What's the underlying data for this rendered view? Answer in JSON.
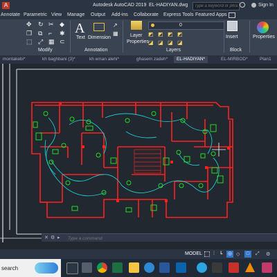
{
  "title_bar": {
    "app_title": "Autodesk AutoCAD 2019",
    "file_title": "EL-HADIYAN.dwg",
    "search_placeholder": "Type a keyword or phrase",
    "sign_in": "Sign In"
  },
  "menu_tabs": [
    "Annotate",
    "Parametric",
    "View",
    "Manage",
    "Output",
    "Add-ins",
    "Collaborate",
    "Express Tools",
    "Featured Apps"
  ],
  "ribbon": {
    "buttons": {
      "text": "Text",
      "dimension": "Dimension",
      "layer_properties_1": "Layer",
      "layer_properties_2": "Properties",
      "insert": "Insert",
      "properties": "Properties"
    },
    "layer_value": "0",
    "panels": {
      "modify": "Modify",
      "annotation": "Annotation",
      "layers": "Layers",
      "block": "Block"
    }
  },
  "file_tabs": [
    "montakebi*",
    "kh baghbani (3)*",
    "kh eman alehi*",
    "ghasem zadeh*",
    "EL-HADIYAN*",
    "EL-MIRBOD*",
    "Plan1"
  ],
  "command_line": {
    "placeholder": "Type a command"
  },
  "status_bar": {
    "model": "MODEL"
  },
  "taskbar": {
    "search": "search"
  },
  "colors": {
    "title_bg": "#2b3442",
    "ribbon_bg": "#3a4352",
    "canvas_bg": "#212830",
    "walls": "#ff2020",
    "fixtures": "#22dd22",
    "wiring": "#20c8c8"
  }
}
